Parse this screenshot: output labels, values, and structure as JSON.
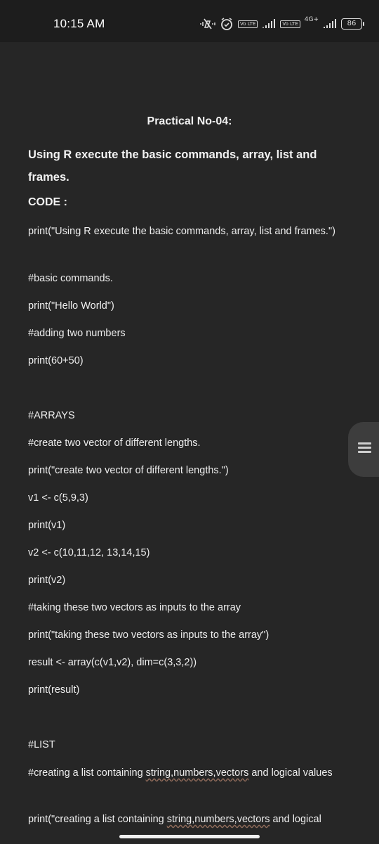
{
  "status_bar": {
    "time": "10:15 AM",
    "lte1": "Vo LTE",
    "lte2": "Vo LTE",
    "network": "4G+",
    "battery": "86"
  },
  "document": {
    "title": "Practical No-04:",
    "heading": "Using R execute the basic commands, array, list and frames.",
    "code_label": "CODE :",
    "lines": [
      "print(\"Using R execute the basic commands, array, list and frames.\")",
      "#basic commands.",
      "print(\"Hello World\")",
      "#adding two numbers",
      "print(60+50)",
      "#ARRAYS",
      "#create two vector of different lengths.",
      "print(\"create two vector of different lengths.\")",
      "v1 <- c(5,9,3)",
      "print(v1)",
      "v2 <- c(10,11,12, 13,14,15)",
      "print(v2)",
      "#taking these two vectors as inputs to the array",
      "print(\"taking these two vectors as inputs to the array\")",
      "result <- array(c(v1,v2), dim=c(3,3,2))",
      "print(result)",
      "#LIST",
      "#creating a list containing string,numbers,vectors and logical values",
      "print(\"creating a list containing string,numbers,vectors and logical"
    ],
    "wavy_segment": "string,numbers,vectors"
  },
  "icons": {
    "mute": "mute-icon",
    "alarm": "alarm-icon",
    "signal": "signal-icon",
    "battery": "battery-icon",
    "scroll": "scroll-handle-icon"
  }
}
